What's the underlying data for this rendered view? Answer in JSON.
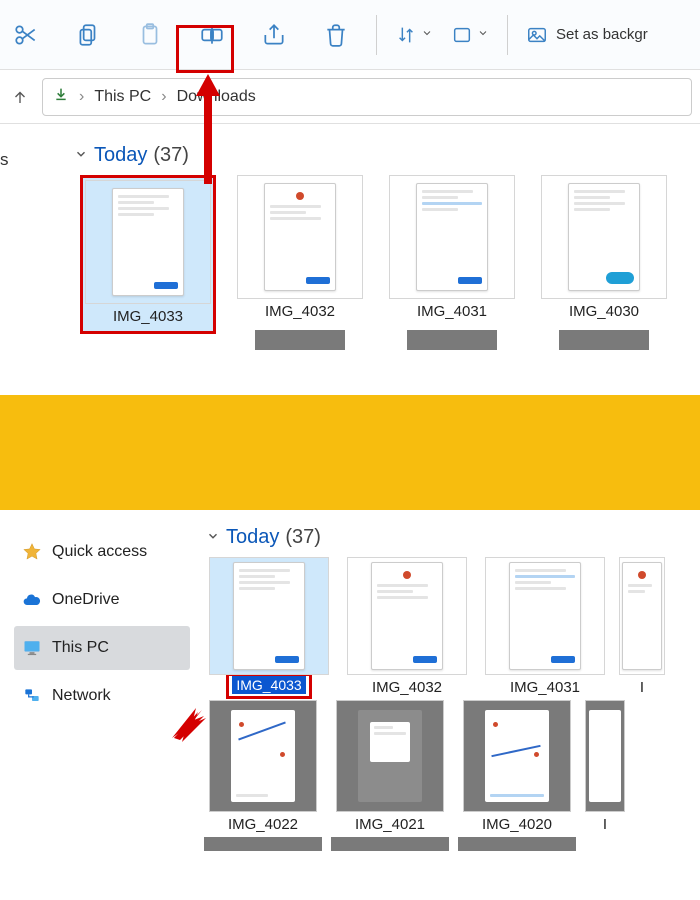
{
  "toolbar": {
    "set_background_label": "Set as backgr"
  },
  "breadcrumb": {
    "this_pc": "This PC",
    "downloads": "Downloads"
  },
  "sidebar_stub": "s",
  "upper_section": {
    "label": "Today",
    "count": "(37)",
    "files": [
      {
        "name": "IMG_4033"
      },
      {
        "name": "IMG_4032"
      },
      {
        "name": "IMG_4031"
      },
      {
        "name": "IMG_4030"
      }
    ]
  },
  "sidebar": {
    "quick_access": "Quick access",
    "onedrive": "OneDrive",
    "this_pc": "This PC",
    "network": "Network"
  },
  "lower_section": {
    "label": "Today",
    "count": "(37)",
    "row1": [
      {
        "name": "IMG_4033",
        "renaming": true
      },
      {
        "name": "IMG_4032"
      },
      {
        "name": "IMG_4031"
      },
      {
        "name": "I"
      }
    ],
    "row2": [
      {
        "name": "IMG_4022"
      },
      {
        "name": "IMG_4021"
      },
      {
        "name": "IMG_4020"
      },
      {
        "name": "I"
      }
    ]
  }
}
